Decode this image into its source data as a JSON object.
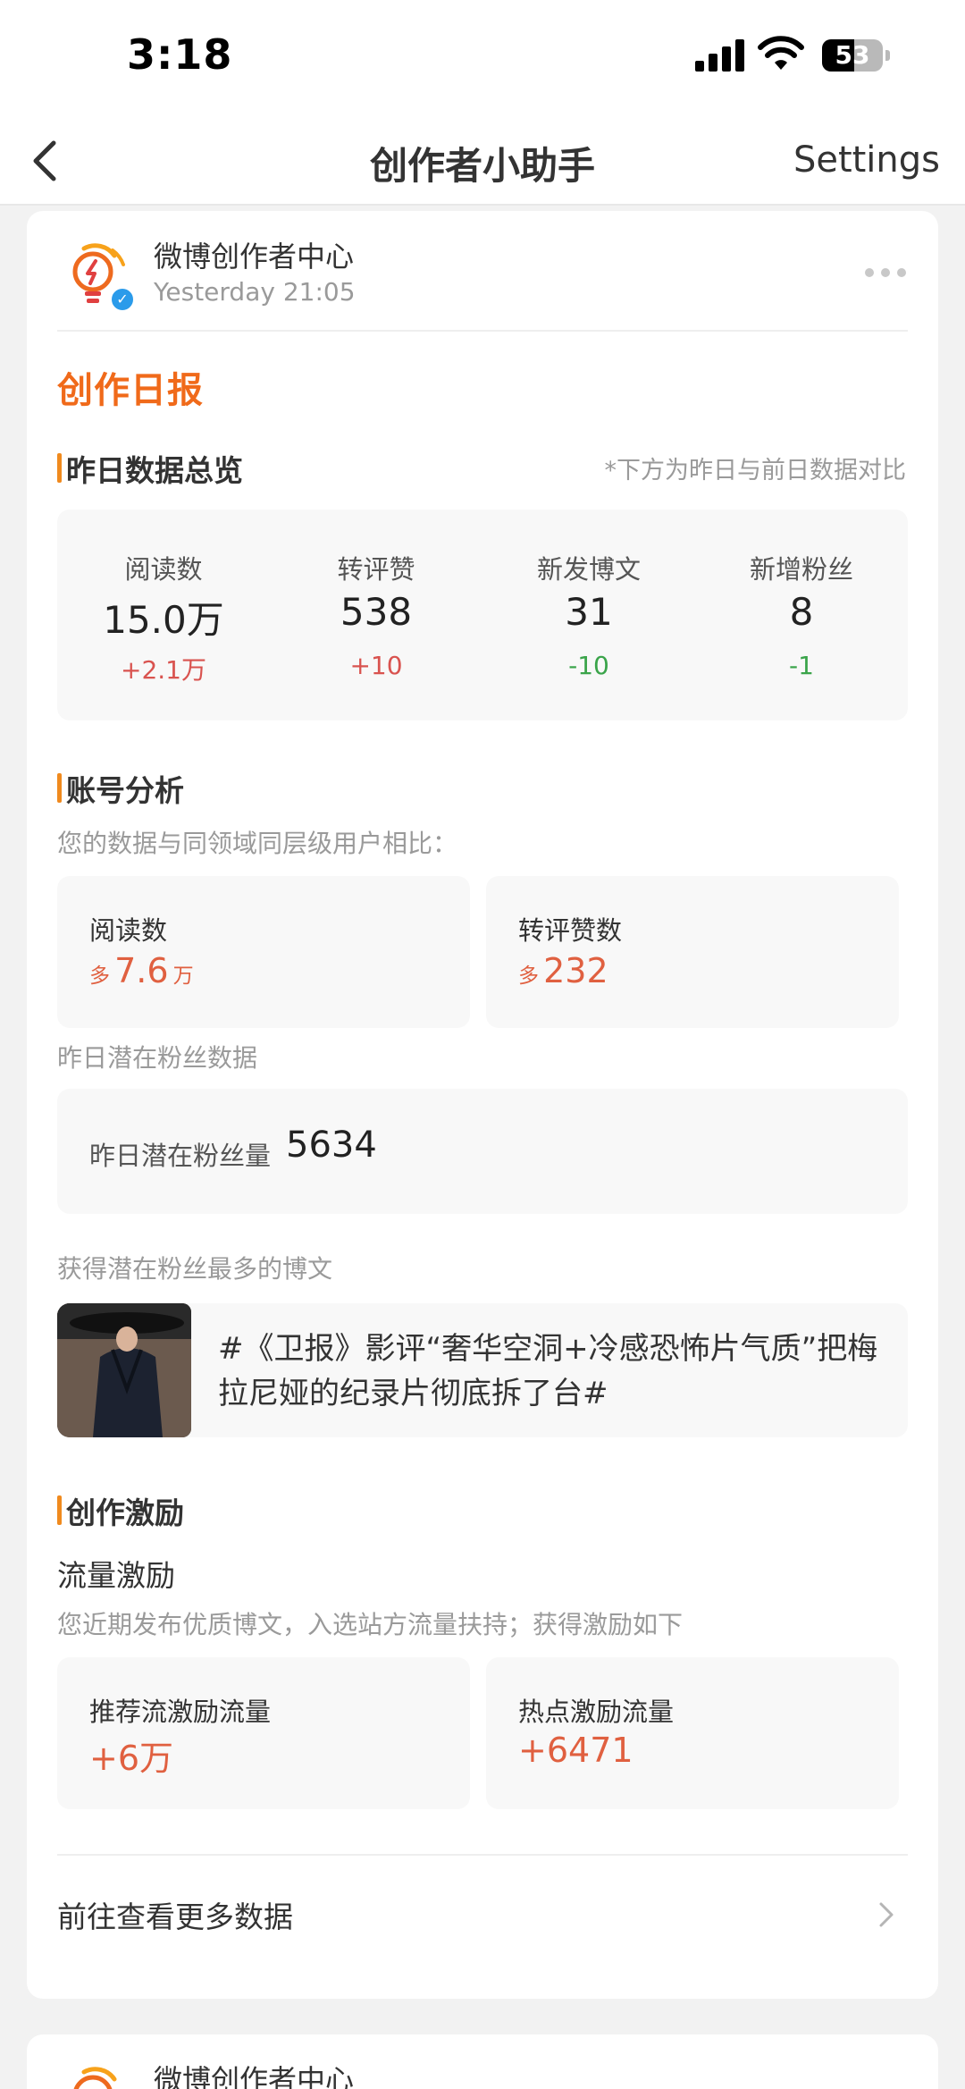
{
  "status_bar": {
    "time": "3:18",
    "battery": "53",
    "battery_level": 0.53
  },
  "nav": {
    "title": "创作者小助手",
    "settings_label": "Settings"
  },
  "post": {
    "account_name": "微博创作者中心",
    "timestamp": "Yesterday 21:05",
    "report_title": "创作日报",
    "overview": {
      "title": "昨日数据总览",
      "note": "*下方为昨日与前日数据对比",
      "stats": [
        {
          "label": "阅读数",
          "value": "15.0万",
          "delta": "+2.1万",
          "trend": "up"
        },
        {
          "label": "转评赞",
          "value": "538",
          "delta": "+10",
          "trend": "up"
        },
        {
          "label": "新发博文",
          "value": "31",
          "delta": "-10",
          "trend": "down"
        },
        {
          "label": "新增粉丝",
          "value": "8",
          "delta": "-1",
          "trend": "down"
        }
      ]
    },
    "analysis": {
      "title": "账号分析",
      "hint": "您的数据与同领域同层级用户相比：",
      "cards": [
        {
          "label": "阅读数",
          "prefix": "多",
          "value": "7.6",
          "suffix": "万"
        },
        {
          "label": "转评赞数",
          "prefix": "多",
          "value": "232",
          "suffix": ""
        }
      ],
      "fans_hint": "昨日潜在粉丝数据",
      "fans_label": "昨日潜在粉丝量",
      "fans_value": "5634",
      "top_post_hint": "获得潜在粉丝最多的博文",
      "top_post_text": "#《卫报》影评“奢华空洞+冷感恐怖片气质”把梅拉尼娅的纪录片彻底拆了台#"
    },
    "incentive": {
      "title": "创作激励",
      "subtitle": "流量激励",
      "hint": "您近期发布优质博文，入选站方流量扶持；获得激励如下",
      "cards": [
        {
          "label": "推荐流激励流量",
          "value": "+6万"
        },
        {
          "label": "热点激励流量",
          "value": "+6471"
        }
      ]
    },
    "more_link": "前往查看更多数据"
  },
  "next_post": {
    "account_name": "微博创作者中心"
  },
  "colors": {
    "accent_orange": "#f06a1a",
    "increase_red": "#d9534f",
    "decrease_green": "#3aa44a",
    "verified_blue": "#2b9bea"
  },
  "icons": [
    "back-chevron-icon",
    "signal-icon",
    "wifi-icon",
    "battery-icon",
    "lightbulb-logo-icon",
    "verified-badge-icon",
    "more-dots-icon",
    "chevron-right-icon"
  ]
}
